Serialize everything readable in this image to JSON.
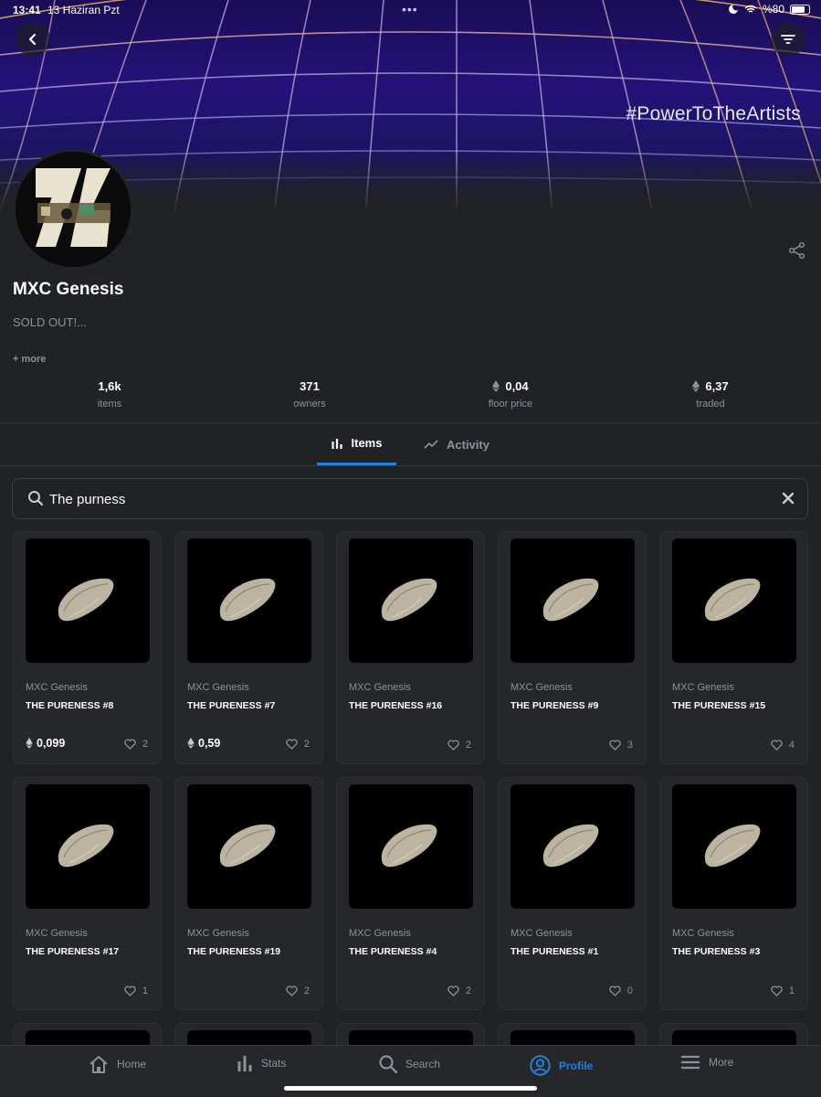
{
  "statusbar": {
    "time": "13:41",
    "date": "13 Haziran Pzt",
    "battery": "%80"
  },
  "banner": {
    "hashtag": "#PowerToTheArtists"
  },
  "collection": {
    "title": "MXC Genesis",
    "description": "SOLD OUT!...",
    "more_label": "+ more"
  },
  "stats": [
    {
      "value": "1,6k",
      "label": "items"
    },
    {
      "value": "371",
      "label": "owners"
    },
    {
      "value": "0,04",
      "label": "floor price"
    },
    {
      "value": "6,37",
      "label": "traded"
    }
  ],
  "tabs": {
    "items": "Items",
    "activity": "Activity"
  },
  "search": {
    "value": "The purness",
    "placeholder": "Search"
  },
  "items": [
    {
      "collection": "MXC Genesis",
      "name": "THE PURENESS #8",
      "price": "0,099",
      "likes": "2"
    },
    {
      "collection": "MXC Genesis",
      "name": "THE PURENESS #7",
      "price": "0,59",
      "likes": "2"
    },
    {
      "collection": "MXC Genesis",
      "name": "THE PURENESS #16",
      "price": "",
      "likes": "2"
    },
    {
      "collection": "MXC Genesis",
      "name": "THE PURENESS #9",
      "price": "",
      "likes": "3"
    },
    {
      "collection": "MXC Genesis",
      "name": "THE PURENESS #15",
      "price": "",
      "likes": "4"
    },
    {
      "collection": "MXC Genesis",
      "name": "THE PURENESS #17",
      "price": "",
      "likes": "1"
    },
    {
      "collection": "MXC Genesis",
      "name": "THE PURENESS #19",
      "price": "",
      "likes": "2"
    },
    {
      "collection": "MXC Genesis",
      "name": "THE PURENESS #4",
      "price": "",
      "likes": "2"
    },
    {
      "collection": "MXC Genesis",
      "name": "THE PURENESS #1",
      "price": "",
      "likes": "0"
    },
    {
      "collection": "MXC Genesis",
      "name": "THE PURENESS #3",
      "price": "",
      "likes": "1"
    }
  ],
  "nav": {
    "home": "Home",
    "stats": "Stats",
    "search": "Search",
    "profile": "Profile",
    "more": "More"
  },
  "colors": {
    "accent": "#2081e2",
    "background": "#202225",
    "card": "#25272b",
    "muted": "#8a939b"
  }
}
